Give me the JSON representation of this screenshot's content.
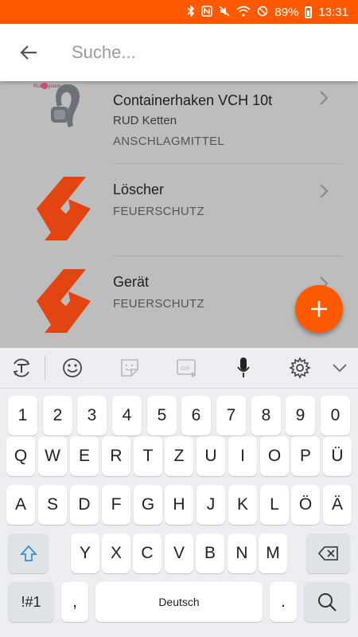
{
  "status_bar": {
    "battery_percent": "89%",
    "time": "13:31",
    "icons": [
      "bluetooth-icon",
      "nfc-icon",
      "mute-icon",
      "wifi-icon",
      "no-disturb-icon",
      "battery-icon"
    ]
  },
  "search": {
    "placeholder": "Suche...",
    "value": ""
  },
  "results": [
    {
      "title": "Containerhaken VCH 10t",
      "subtitle": "RUD Ketten",
      "category": "ANSCHLAGMITTEL",
      "icon": "rud-hook-image"
    },
    {
      "title": "Löscher",
      "subtitle": "",
      "category": "FEUERSCHUTZ",
      "icon": "feuerschutz-logo-icon"
    },
    {
      "title": "Gerät",
      "subtitle": "",
      "category": "FEUERSCHUTZ",
      "icon": "feuerschutz-logo-icon"
    }
  ],
  "rud_logo_text": "RUD System",
  "fab_icon": "plus-icon",
  "keyboard": {
    "toolbar": [
      "text-mode-icon",
      "emoji-icon",
      "sticker-icon",
      "gif-icon",
      "microphone-icon",
      "settings-icon",
      "collapse-icon"
    ],
    "gif_label": "GIF",
    "rows": [
      [
        "1",
        "2",
        "3",
        "4",
        "5",
        "6",
        "7",
        "8",
        "9",
        "0"
      ],
      [
        "Q",
        "W",
        "E",
        "R",
        "T",
        "Z",
        "U",
        "I",
        "O",
        "P",
        "Ü"
      ],
      [
        "A",
        "S",
        "D",
        "F",
        "G",
        "H",
        "J",
        "K",
        "L",
        "Ö",
        "Ä"
      ],
      [
        "Y",
        "X",
        "C",
        "V",
        "B",
        "N",
        "M"
      ]
    ],
    "symbols_key": "!#1",
    "comma_key": ",",
    "space_label": "Deutsch",
    "period_key": "."
  },
  "colors": {
    "accent": "#ff5a00",
    "feuerschutz": "#e24512",
    "keyboard_bg": "#eceef1"
  }
}
